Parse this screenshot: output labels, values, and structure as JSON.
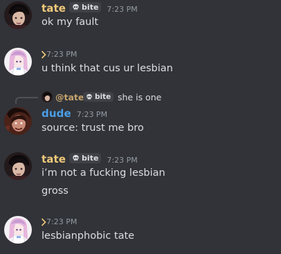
{
  "users": {
    "tate": {
      "name": "tate",
      "color": "#f0c97a",
      "tag": "bite"
    },
    "dude": {
      "name": "dude",
      "color": "#4b9fe8"
    }
  },
  "messages": [
    {
      "author": "tate",
      "tag": "bite",
      "time": "7:23 PM",
      "lines": [
        "ok my fault"
      ]
    },
    {
      "author": "",
      "time": "7:23 PM",
      "lines": [
        "u think that cus ur lesbian"
      ]
    },
    {
      "reply": {
        "mention": "@tate",
        "tag": "bite",
        "text": "she is one"
      },
      "author": "dude",
      "time": "7:23 PM",
      "lines": [
        "source: trust me bro"
      ]
    },
    {
      "author": "tate",
      "tag": "bite",
      "time": "7:23 PM",
      "lines": [
        "i’m not a fucking lesbian",
        "gross"
      ]
    },
    {
      "author": "",
      "time": "7:23 PM",
      "lines": [
        "lesbianphobic tate"
      ]
    }
  ]
}
